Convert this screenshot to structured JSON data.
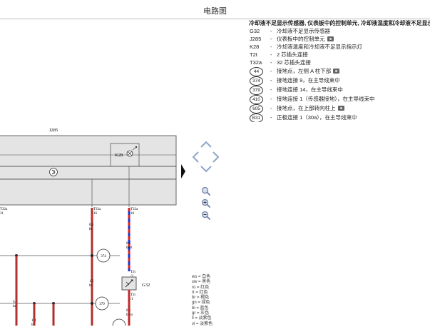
{
  "window": {
    "title": "电路图"
  },
  "legend": {
    "heading": "冷却液不足显示传感器, 仪表板中的控制单元, 冷却液温度和冷却液不足显示灯",
    "items": [
      {
        "code": "G32",
        "text": "冷却液不足显示传感器",
        "camera": false
      },
      {
        "code": "J285",
        "text": "仪表板中的控制单元",
        "camera": true
      },
      {
        "code": "K28",
        "text": "冷却液温度和冷却液不足显示指示灯",
        "camera": false
      },
      {
        "code": "T2t",
        "text": "2 芯插头连接",
        "camera": false
      },
      {
        "code": "T32a",
        "text": "32 芯插头连接",
        "camera": false
      }
    ],
    "ground_items": [
      {
        "code": "44",
        "text": "接地点，左侧 A 柱下部",
        "camera": true
      },
      {
        "code": "374",
        "text": "接地连接 9，在主导线束中",
        "camera": false
      },
      {
        "code": "379",
        "text": "接地连接 14，在主导线束中",
        "camera": false
      },
      {
        "code": "410",
        "text": "接地连接 1（传感器接地），在主导线束中",
        "camera": false
      },
      {
        "code": "605",
        "text": "接地点，在上部转向柱上",
        "camera": true
      },
      {
        "code": "B31",
        "text": "正极连接 1（30a），在主导线束中",
        "camera": false
      }
    ]
  },
  "diagram": {
    "component_label": "J285",
    "indicator_label": "K28",
    "sensor_label": "G32",
    "connector_labels": {
      "left_top": "T32a",
      "left_pin": "31",
      "c1_top": "T32a",
      "c1_pin": "16",
      "c2_top": "T32a",
      "c2_pin": "18",
      "g32_top": "T2t",
      "g32_top_pin": "/2",
      "g32_bot": "T2t",
      "g32_bot_pin": "/1"
    },
    "wire_labels": {
      "w1_size": "0.5",
      "w1_color": "br",
      "w2_size": "0.5",
      "w2_color": "bl/rt",
      "w3_size": "1.5",
      "w3_color": "br",
      "w4_size": "0.5",
      "w4_color": "br/rs",
      "w5_size": "0.5",
      "w5_color": "br",
      "w6_size": "1.0",
      "w6_color": "br"
    },
    "ground_markers": {
      "g1": "374",
      "g2": "379"
    },
    "colors": {
      "wire_brown": "#b0302e",
      "wire_blue": "#2233cc",
      "wire_red": "#dd2222",
      "panel": "#e4e4e4",
      "nav_blue": "#8fa5c8"
    }
  },
  "color_key": [
    "ws = 白色",
    "sw = 黑色",
    "ro = 红色",
    "rt = 红色",
    "br = 褐色",
    "gn = 绿色",
    "bl = 蓝色",
    "gr = 灰色",
    "li = 淡紫色",
    "vi = 淡紫色"
  ],
  "nav": {
    "up_icon": "chevron-up-icon",
    "left_icon": "chevron-left-icon",
    "right_icon": "chevron-right-icon",
    "down_icon": "chevron-down-icon",
    "zoom_in_icon": "zoom-in-icon",
    "zoom_out_icon": "zoom-out-icon"
  }
}
